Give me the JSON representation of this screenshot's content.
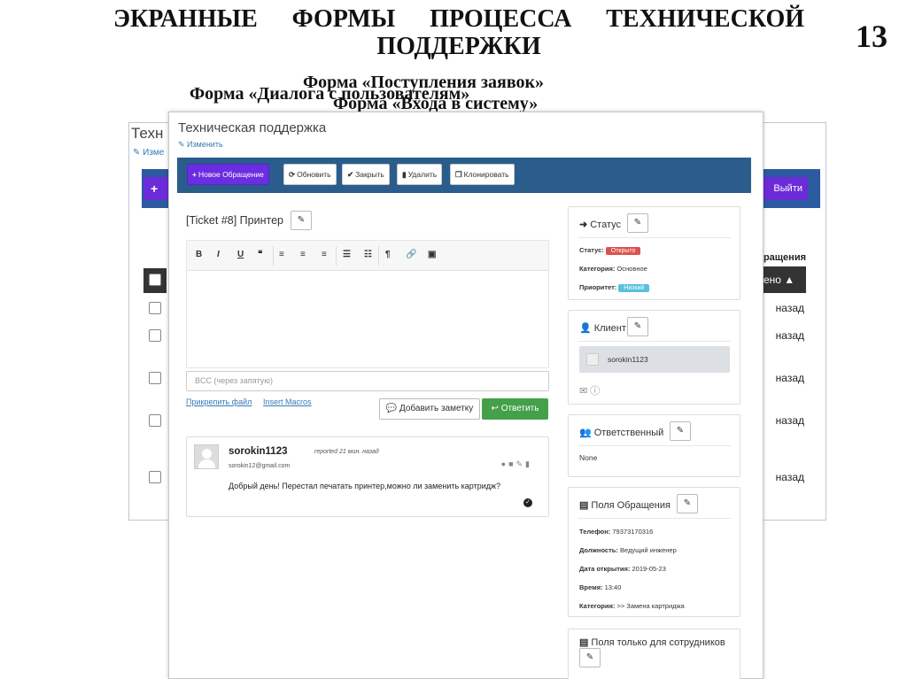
{
  "slide": {
    "title_line1": "ЭКРАННЫЕ ФОРМЫ ПРОЦЕССА ТЕХНИЧЕСКОЙ",
    "title_line2": "ПОДДЕРЖКИ",
    "number": "13",
    "captions": [
      "Форма «Поступления заявок»",
      "Форма «Диалога с пользователям»",
      "Форма «Входа в систему»"
    ]
  },
  "background_window": {
    "title": "Техн",
    "edit": "✎ Изме",
    "right_button": "Выйти",
    "column_header": "ращения",
    "sort_label": "ено ▲",
    "rows_ago": [
      "назад",
      "назад",
      "назад",
      "назад",
      "назад"
    ]
  },
  "window": {
    "title": "Техническая поддержка",
    "edit_link": "✎ Изменить",
    "toolbar": {
      "new": "Новое Обращение",
      "refresh": "Обновить",
      "close": "Закрыть",
      "delete": "Удалить",
      "clone": "Клонировать"
    },
    "ticket_title": "[Ticket #8] Принтер",
    "editor": {
      "bold": "B",
      "italic": "I",
      "underline": "U",
      "quote": "❝",
      "align_left": "≡",
      "align_center": "≡",
      "align_right": "≡",
      "bullet_list": "☰",
      "numbered_list": "☷",
      "paragraph": "¶",
      "link": "🔗",
      "image": "▣"
    },
    "bcc_placeholder": "BCC (через запятую)",
    "attach_link": "Прикрепить файл",
    "macros_link": "Insert Macros",
    "add_note": "Добавить заметку",
    "reply": "Ответить",
    "message": {
      "user": "sorokin1123",
      "meta": "reported 21 мин. назад",
      "email": "sorokin12@gmail.com",
      "text": "Добрый день! Перестал печатать принтер,можно ли заменить картридж?"
    },
    "panels": {
      "status": {
        "title": "Статус",
        "status_label": "Статус:",
        "status_value": "Открыто",
        "category_label": "Категория:",
        "category_value": "Основное",
        "priority_label": "Приоритет:",
        "priority_value": "Низкий"
      },
      "client": {
        "title": "Клиент",
        "name": "sorokin1123"
      },
      "assignee": {
        "title": "Ответственный",
        "value": "None"
      },
      "fields": {
        "title": "Поля Обращения",
        "phone_label": "Телефон:",
        "phone_value": "79373170316",
        "position_label": "Должность:",
        "position_value": "Ведущий инженер",
        "opened_label": "Дата открытия:",
        "opened_value": "2019-05-23",
        "time_label": "Время:",
        "time_value": "13:40",
        "category_label": "Категория:",
        "category_value": ">> Замена картриджа"
      },
      "staff": {
        "title": "Поля только для сотрудников"
      }
    }
  },
  "colors": {
    "toolbar_bg": "#2a5d8c",
    "primary_button": "#6a2ee0",
    "reply_button": "#44a04a",
    "status_badge": "#d9534f",
    "priority_badge": "#5bc0de"
  }
}
